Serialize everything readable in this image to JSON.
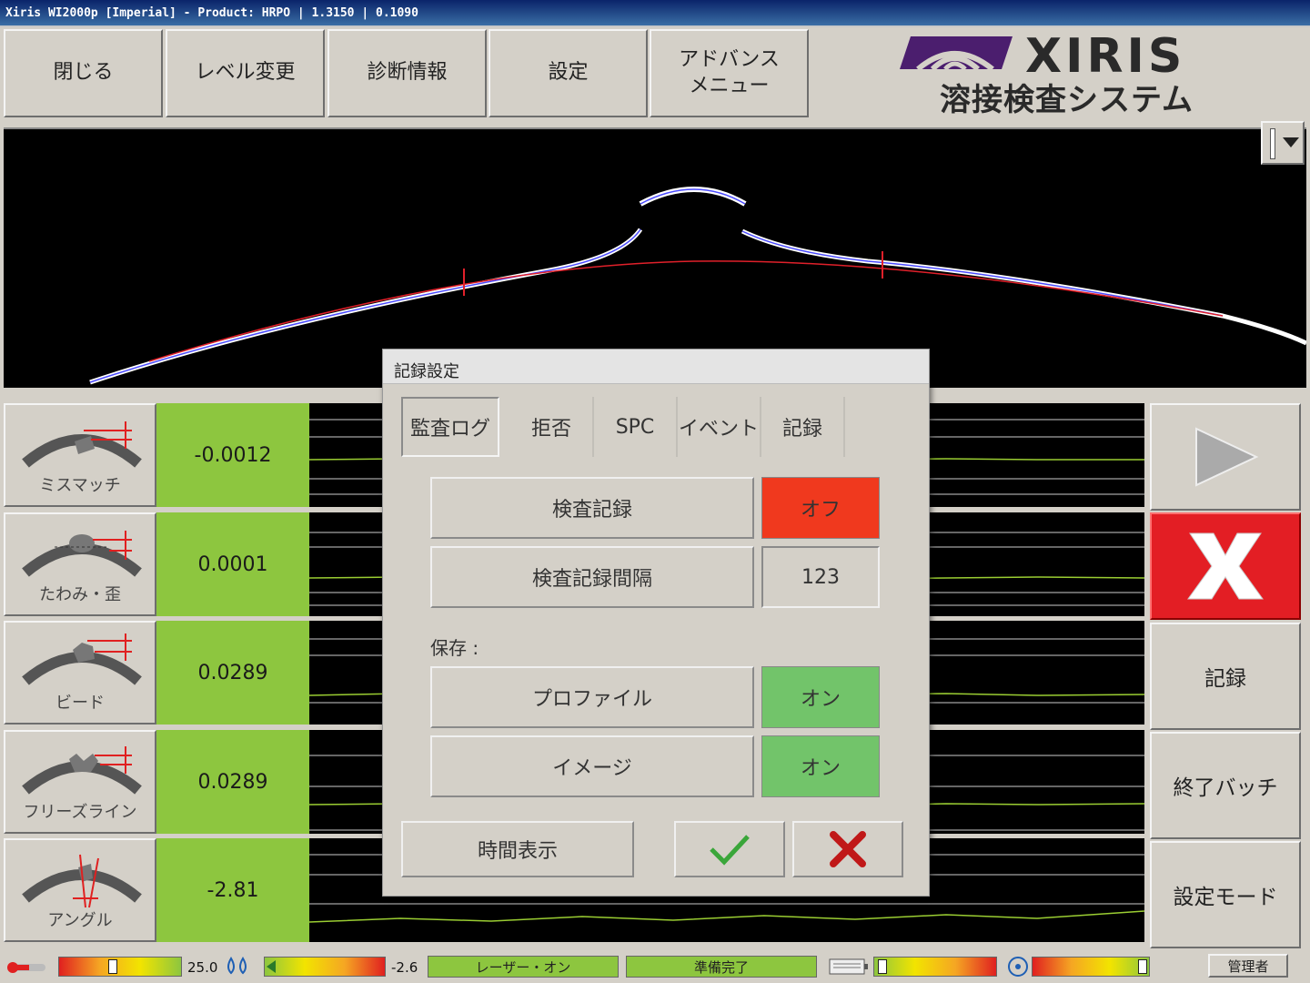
{
  "window": {
    "title": "Xiris WI2000p [Imperial] - Product: HRPO | 1.3150 | 0.1090"
  },
  "toolbar": {
    "close": "閉じる",
    "level_change": "レベル変更",
    "diagnostics": "診断情報",
    "settings": "設定",
    "advanced_menu": "アドバンス\nメニュー"
  },
  "brand": {
    "name": "XIRIS",
    "subtitle": "溶接検査システム",
    "accent": "#4b1e6e"
  },
  "measurements": [
    {
      "label": "ミスマッチ",
      "value": "-0.0012"
    },
    {
      "label": "たわみ・歪",
      "value": "0.0001"
    },
    {
      "label": "ビード",
      "value": "0.0289"
    },
    {
      "label": "フリーズライン",
      "value": "0.0289"
    },
    {
      "label": "アングル",
      "value": "-2.81"
    }
  ],
  "right_panel": {
    "record": "記録",
    "end_batch": "終了バッチ",
    "setup_mode": "設定モード",
    "stop_color": "#e31e24"
  },
  "dialog": {
    "title": "記録設定",
    "tabs": [
      "監査ログ",
      "拒否",
      "SPC",
      "イベント",
      "記録"
    ],
    "inspection_record": {
      "label": "検査記録",
      "value": "オフ",
      "color": "#f0391e"
    },
    "inspection_interval": {
      "label": "検査記録間隔",
      "value": "123"
    },
    "save_label": "保存 :",
    "profile": {
      "label": "プロファイル",
      "value": "オン",
      "color": "#72c46a"
    },
    "image": {
      "label": "イメージ",
      "value": "オン",
      "color": "#72c46a"
    },
    "time_display": "時間表示"
  },
  "status": {
    "temperature": "25.0",
    "laser_value": "-2.6",
    "laser_status": "レーザー・オン",
    "ready": "準備完了",
    "user": "管理者"
  }
}
